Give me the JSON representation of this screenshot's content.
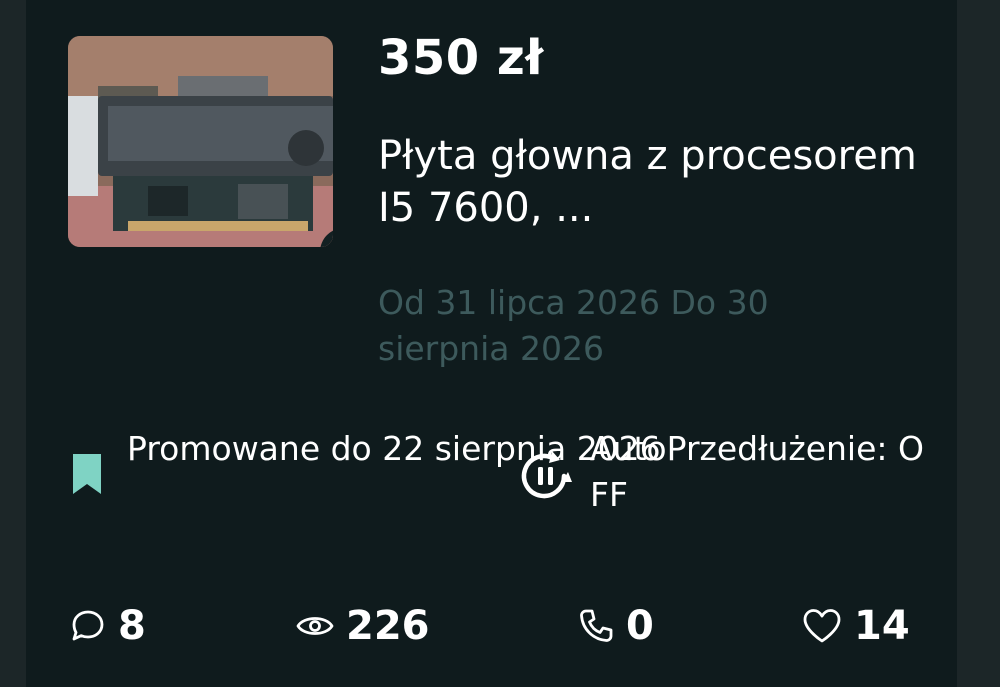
{
  "listing": {
    "price": "350 zł",
    "title": "Płyta głowna  z procesorem I5 7600,  ...",
    "dates": "Od 31 lipca 2026 Do 30 sierpnia 2026",
    "thumbnail_icon": "delivery-truck-icon"
  },
  "promotion": {
    "text": "Promowane do 22 sierpnia 2026",
    "icon": "bookmark-icon",
    "color": "#7fd3c4"
  },
  "auto_renew": {
    "text": "AutoPrzedłużenie: OFF",
    "icon": "pause-refresh-icon"
  },
  "stats": {
    "messages": "8",
    "views": "226",
    "calls": "0",
    "favorites": "14"
  },
  "colors": {
    "background": "#0f1b1d",
    "muted_text": "#3d5a5c",
    "accent": "#7fd3c4"
  }
}
